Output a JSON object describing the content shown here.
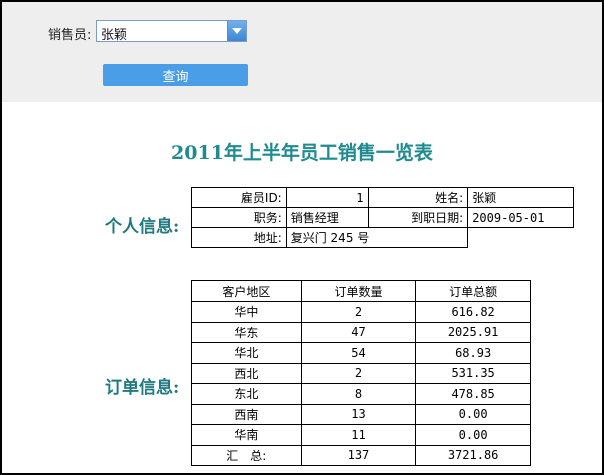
{
  "filter": {
    "salesperson_label": "销售员:",
    "salesperson_value": "张颖",
    "query_button": "查询"
  },
  "report": {
    "title": "2011年上半年员工销售一览表",
    "personal_label": "个人信息:",
    "orders_label": "订单信息:",
    "personal": {
      "employee_id_label": "雇员ID:",
      "employee_id": "1",
      "name_label": "姓名:",
      "name": "张颖",
      "position_label": "职务:",
      "position": "销售经理",
      "hire_date_label": "到职日期:",
      "hire_date": "2009-05-01",
      "address_label": "地址:",
      "address": "复兴门 245 号"
    },
    "orders": {
      "headers": [
        "客户地区",
        "订单数量",
        "订单总额"
      ],
      "rows": [
        [
          "华中",
          "2",
          "616.82"
        ],
        [
          "华东",
          "47",
          "2025.91"
        ],
        [
          "华北",
          "54",
          "68.93"
        ],
        [
          "西北",
          "2",
          "531.35"
        ],
        [
          "东北",
          "8",
          "478.85"
        ],
        [
          "西南",
          "13",
          "0.00"
        ],
        [
          "华南",
          "11",
          "0.00"
        ]
      ],
      "total": [
        "汇　总:",
        "137",
        "3721.86"
      ]
    }
  },
  "colors": {
    "title": "#1f8a8f",
    "button": "#4a9ee8",
    "filter_bg": "#eeeeee"
  }
}
